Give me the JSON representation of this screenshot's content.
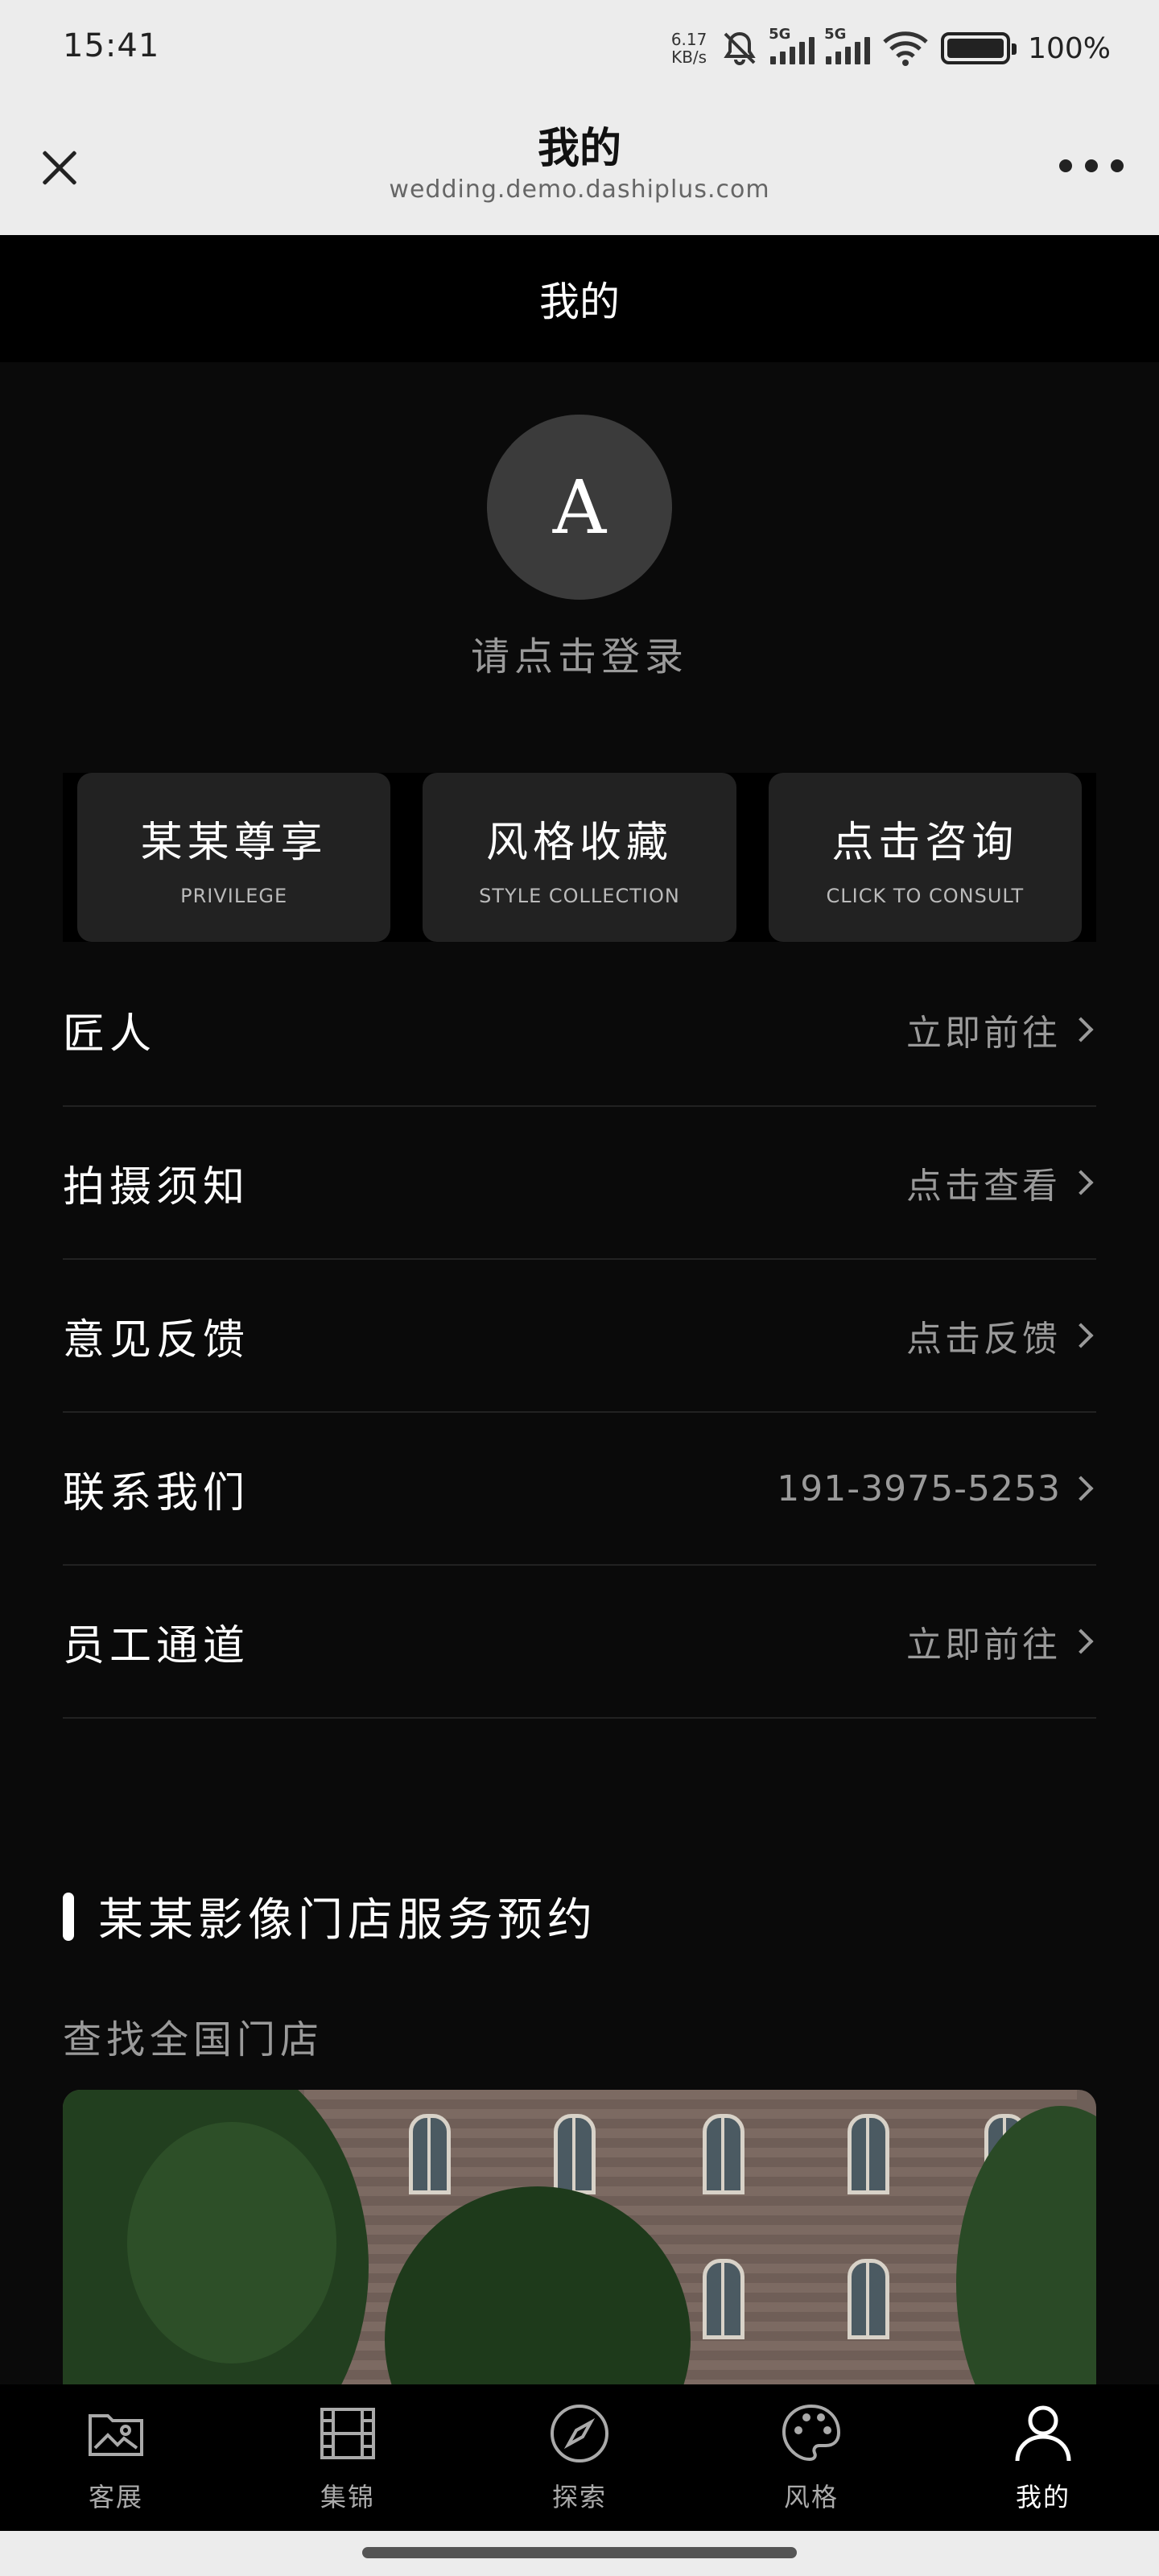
{
  "status_bar": {
    "time": "15:41",
    "net_speed": "6.17\nKB/s",
    "sim1": "5G",
    "sim2": "5G",
    "battery": "100%"
  },
  "app_header": {
    "title": "我的",
    "url": "wedding.demo.dashiplus.com"
  },
  "page": {
    "title": "我的"
  },
  "profile": {
    "avatar_letter": "A",
    "login_text": "请点击登录"
  },
  "cards": [
    {
      "title": "某某尊享",
      "subtitle": "PRIVILEGE"
    },
    {
      "title": "风格收藏",
      "subtitle": "STYLE COLLECTION"
    },
    {
      "title": "点击咨询",
      "subtitle": "CLICK TO CONSULT"
    }
  ],
  "menu": [
    {
      "label": "匠人",
      "value": "立即前往"
    },
    {
      "label": "拍摄须知",
      "value": "点击查看"
    },
    {
      "label": "意见反馈",
      "value": "点击反馈"
    },
    {
      "label": "联系我们",
      "value": "191-3975-5253"
    },
    {
      "label": "员工通道",
      "value": "立即前往"
    }
  ],
  "section": {
    "title": "某某影像门店服务预约",
    "subtitle": "查找全国门店"
  },
  "tabbar": [
    {
      "label": "客展",
      "icon": "gallery-icon",
      "active": false
    },
    {
      "label": "集锦",
      "icon": "film-icon",
      "active": false
    },
    {
      "label": "探索",
      "icon": "compass-icon",
      "active": false
    },
    {
      "label": "风格",
      "icon": "palette-icon",
      "active": false
    },
    {
      "label": "我的",
      "icon": "user-icon",
      "active": true
    }
  ]
}
